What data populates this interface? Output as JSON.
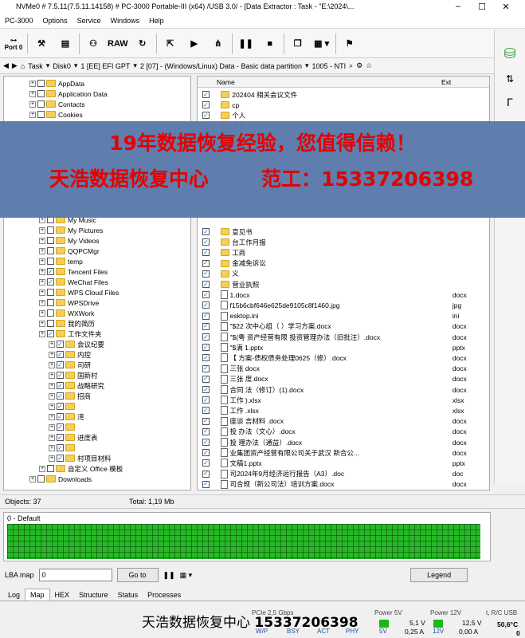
{
  "titlebar": {
    "title": "NVMe0 # 7.5.11(7.5.11.14158) # PC-3000 Portable-III (x64) /USB 3.0/ - [Data Extractor : Task - \"E:\\2024\\...",
    "min": "–",
    "max": "☐",
    "close": "✕"
  },
  "menu": [
    "PC-3000",
    "Options",
    "Service",
    "Windows",
    "Help"
  ],
  "toolbar": {
    "port_label": "Port 0",
    "raw_label": "RAW"
  },
  "pathbar": {
    "task": "Task",
    "disk": "Disk0",
    "part1": "1 [EE] EFI GPT",
    "part2": "2 [07] - (Windows/Linux) Data - Basic data partition",
    "node": "1005 - NTI"
  },
  "tree": [
    {
      "indent": 2,
      "label": "AppData",
      "check": false
    },
    {
      "indent": 2,
      "label": "Application Data",
      "check": false
    },
    {
      "indent": 2,
      "label": "Contacts",
      "check": false
    },
    {
      "indent": 2,
      "label": "Cookies",
      "check": false
    },
    {
      "indent": 3,
      "label": "My Music",
      "check": false
    },
    {
      "indent": 3,
      "label": "My Pictures",
      "check": false
    },
    {
      "indent": 3,
      "label": "My Videos",
      "check": false
    },
    {
      "indent": 3,
      "label": "QQPCMgr",
      "check": false
    },
    {
      "indent": 3,
      "label": "temp",
      "check": false
    },
    {
      "indent": 3,
      "label": "Tencent Files",
      "check": true
    },
    {
      "indent": 3,
      "label": "WeChat Files",
      "check": true
    },
    {
      "indent": 3,
      "label": "WPS Cloud Files",
      "check": false
    },
    {
      "indent": 3,
      "label": "WPSDrive",
      "check": false
    },
    {
      "indent": 3,
      "label": "WXWork",
      "check": false
    },
    {
      "indent": 3,
      "label": "我的简历",
      "check": false
    },
    {
      "indent": 3,
      "label": "工作文件夹",
      "check": true
    },
    {
      "indent": 4,
      "label": "会议纪要",
      "check": true
    },
    {
      "indent": 4,
      "label": "内控",
      "check": true
    },
    {
      "indent": 4,
      "label": "司研",
      "check": true
    },
    {
      "indent": 4,
      "label": "国新村",
      "check": true
    },
    {
      "indent": 4,
      "label": "战略研究",
      "check": true
    },
    {
      "indent": 4,
      "label": "招商",
      "check": true
    },
    {
      "indent": 4,
      "label": "",
      "check": true
    },
    {
      "indent": 4,
      "label": "湾",
      "check": true
    },
    {
      "indent": 4,
      "label": "",
      "check": true
    },
    {
      "indent": 4,
      "label": "进度表",
      "check": true
    },
    {
      "indent": 4,
      "label": "",
      "check": true
    },
    {
      "indent": 4,
      "label": "村项目材料",
      "check": true
    },
    {
      "indent": 3,
      "label": "自定义 Office 模板",
      "check": false
    },
    {
      "indent": 2,
      "label": "Downloads",
      "check": false
    }
  ],
  "files_header": {
    "name": "Name",
    "ext": "Ext"
  },
  "files": [
    {
      "name": "202404 相关会议文件",
      "ext": "",
      "type": "folder"
    },
    {
      "name": "cp",
      "ext": "",
      "type": "folder"
    },
    {
      "name": "个人",
      "ext": "",
      "type": "folder"
    },
    {
      "name": "个人",
      "ext": "",
      "type": "folder"
    },
    {
      "name": "意见书",
      "ext": "",
      "type": "folder"
    },
    {
      "name": "台工作月报",
      "ext": "",
      "type": "folder"
    },
    {
      "name": "工商",
      "ext": "",
      "type": "folder"
    },
    {
      "name": "金减免诉讼",
      "ext": "",
      "type": "folder"
    },
    {
      "name": "义",
      "ext": "",
      "type": "folder"
    },
    {
      "name": "营业执照",
      "ext": "",
      "type": "folder"
    },
    {
      "name": "1.docx",
      "ext": "docx",
      "type": "file"
    },
    {
      "name": "f15b6cbf646e625de9105c8f1460.jpg",
      "ext": "jpg",
      "type": "file"
    },
    {
      "name": "esktop.ini",
      "ext": "ini",
      "type": "file"
    },
    {
      "name": "\"$22 次中心组（ ）学习方案.docx",
      "ext": "docx",
      "type": "file"
    },
    {
      "name": "\"$(粤 资产经营有限 投资管理办法（旧批注）.docx",
      "ext": "docx",
      "type": "file"
    },
    {
      "name": "\"$满 1.pptx",
      "ext": "pptx",
      "type": "file"
    },
    {
      "name": "【 方案-债权债务处理0625（修）.docx",
      "ext": "docx",
      "type": "file"
    },
    {
      "name": "三张 docx",
      "ext": "docx",
      "type": "file"
    },
    {
      "name": "三张 度.docx",
      "ext": "docx",
      "type": "file"
    },
    {
      "name": "合同 法（修订）(1).docx",
      "ext": "docx",
      "type": "file"
    },
    {
      "name": "工作 ).xlsx",
      "ext": "xlsx",
      "type": "file"
    },
    {
      "name": "工作 .xlsx",
      "ext": "xlsx",
      "type": "file"
    },
    {
      "name": "座谈 言材料 .docx",
      "ext": "docx",
      "type": "file"
    },
    {
      "name": "投 办法（文心）.docx",
      "ext": "docx",
      "type": "file"
    },
    {
      "name": "投 理办法（通益）.docx",
      "ext": "docx",
      "type": "file"
    },
    {
      "name": "业集团资产经营有限公司关于武汉 新合公...",
      "ext": "docx",
      "type": "file"
    },
    {
      "name": "文稿1.pptx",
      "ext": "pptx",
      "type": "file"
    },
    {
      "name": "司2024年9月经济运行报告（A3）.doc",
      "ext": "doc",
      "type": "file"
    },
    {
      "name": "司合规（新公司法）培训方案.docx",
      "ext": "docx",
      "type": "file"
    }
  ],
  "overlay": {
    "line1": "19年数据恢复经验，您值得信赖！",
    "line2a": "天浩数据恢复中心",
    "line2b": "范工：15337206398"
  },
  "status": {
    "objects": "Objects: 37",
    "total": "Total: 1,19 Mb"
  },
  "map": {
    "title": "0 - Default",
    "color": "#26b826"
  },
  "lba": {
    "label": "LBA map",
    "value": "0",
    "goto": "Go to",
    "legend": "Legend"
  },
  "tabs": [
    "Log",
    "Map",
    "HEX",
    "Structure",
    "Status",
    "Processes"
  ],
  "footer": {
    "watermark_a": "天浩数据恢复中心 ",
    "watermark_b": "15337206398",
    "pcie": "PCIe 2,5 Gbps",
    "wp": "W/P",
    "bsy": "BSY",
    "act": "ACT",
    "phy": "PHY",
    "p5": "Power 5V",
    "p5v": "5V",
    "p5val": "5,1 V",
    "p5cur": "0,25 A",
    "p12": "Power 12V",
    "p12v": "12V",
    "p12val": "12,5 V",
    "p12cur": "0,00 A",
    "temp_label": "t, R/C USB",
    "temp": "50,6°C",
    "usb": "0"
  }
}
